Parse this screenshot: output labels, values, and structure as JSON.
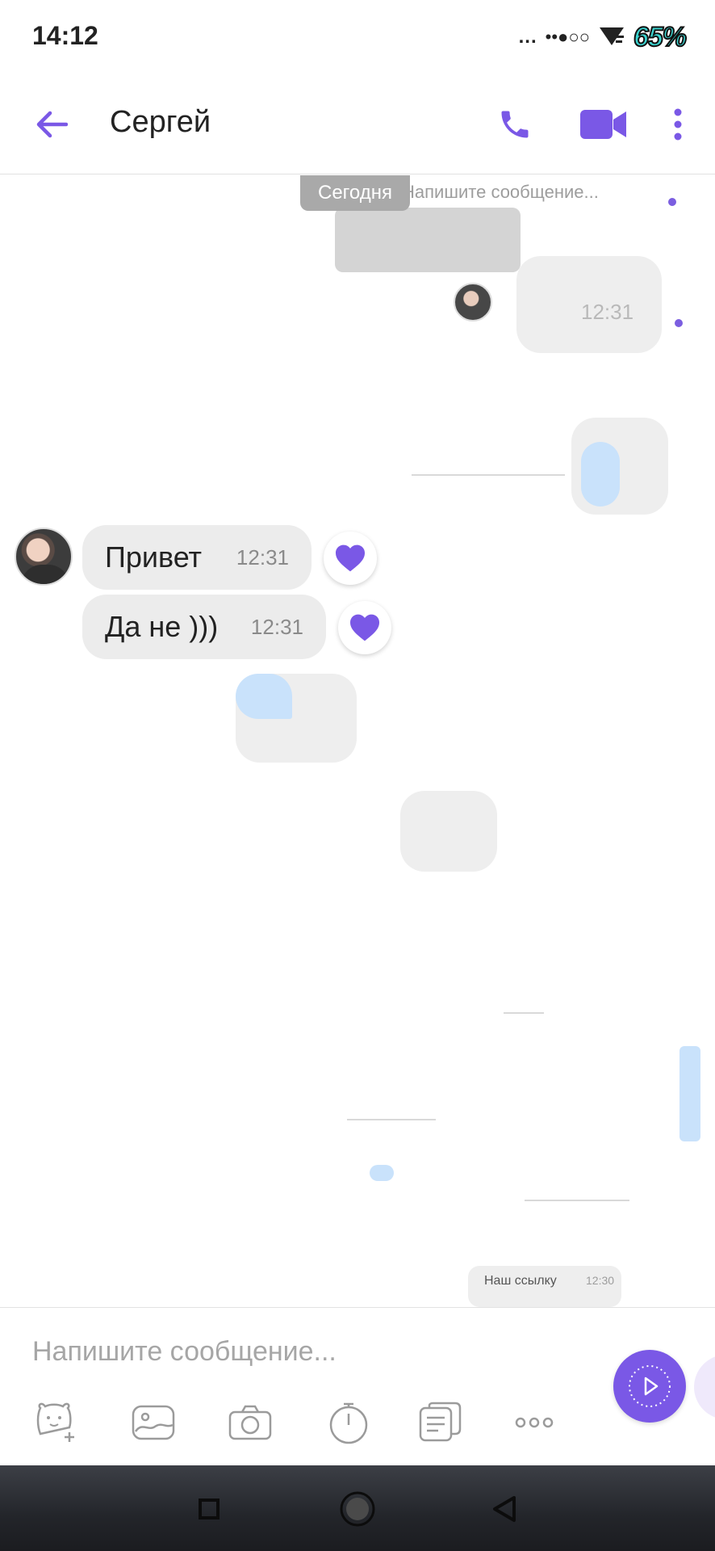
{
  "status_bar": {
    "time": "14:12",
    "dots": "...",
    "signal": "••●○○",
    "battery": "65%"
  },
  "header": {
    "title": "Сергей"
  },
  "chat": {
    "date_label": "Сегодня",
    "messages": [
      {
        "text": "Привет",
        "time": "12:31",
        "liked": true
      },
      {
        "text": "Да не )))",
        "time": "12:31",
        "liked": true
      }
    ],
    "ghost_texts": {
      "top_placeholder": "Напишите сообщение...",
      "top_time": "12:31",
      "partial_link": "Наш ссылку",
      "partial_time": "12:30"
    }
  },
  "input": {
    "placeholder": "Напишите сообщение..."
  },
  "colors": {
    "accent": "#7a58e6",
    "bubble": "#ececec",
    "battery": "#3ad3cf"
  },
  "icons": {
    "back": "arrow-left-icon",
    "call": "phone-icon",
    "video": "video-camera-icon",
    "more": "more-vertical-icon",
    "sticker": "sticker-icon",
    "gallery": "gallery-icon",
    "camera": "camera-icon",
    "timer": "timer-icon",
    "gif": "gif-icon",
    "more_tools": "more-horizontal-icon",
    "send": "send-icon"
  }
}
